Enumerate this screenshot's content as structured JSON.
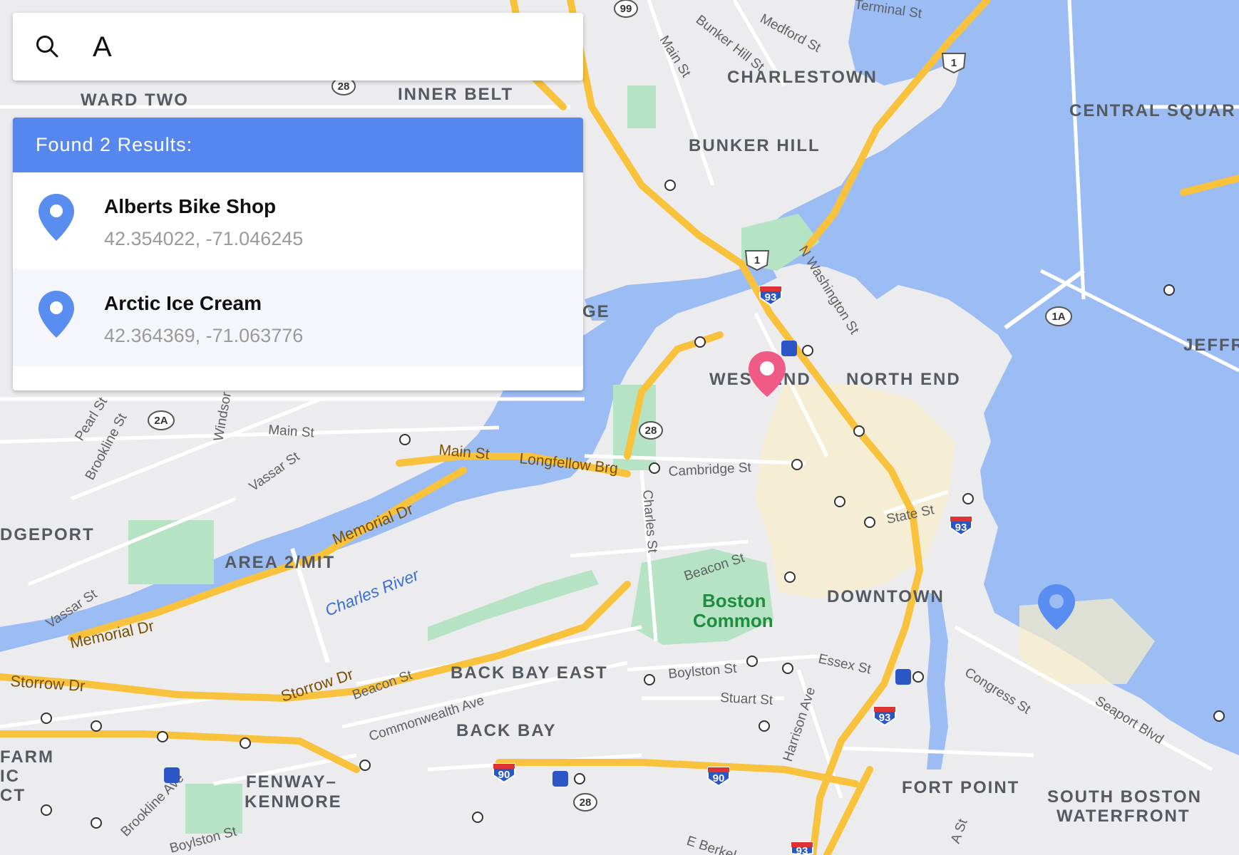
{
  "search": {
    "value": "A",
    "icon": "search-icon"
  },
  "results": {
    "header": "Found 2 Results:",
    "items": [
      {
        "name": "Alberts Bike Shop",
        "coords": "42.354022, -71.046245",
        "icon": "location-pin-icon",
        "color": "#5a8df0"
      },
      {
        "name": "Arctic Ice Cream",
        "coords": "42.364369, -71.063776",
        "icon": "location-pin-icon",
        "color": "#5a8df0"
      }
    ]
  },
  "map": {
    "colors": {
      "water": "#9cbcf4",
      "land": "#ececef",
      "park": "#b5e3c3",
      "highway": "#f8c23c",
      "accent_pin": "#ef5a86",
      "result_pin": "#5a8df0"
    },
    "neighborhoods": [
      "WARD TWO",
      "INNER BELT",
      "CHARLESTOWN",
      "BUNKER HILL",
      "CENTRAL SQUAR",
      "WEST END",
      "NORTH END",
      "JEFFR",
      "DGEPORT",
      "AREA 2/MIT",
      "DOWNTOWN",
      "BACK BAY EAST",
      "BACK BAY",
      "FENWAY–",
      "KENMORE",
      "FORT POINT",
      "SOUTH BOSTON",
      "WATERFRONT",
      "FARM",
      "IC",
      "CT",
      "GE"
    ],
    "streets": [
      "Medford St",
      "Bunker Hill St",
      "Main St",
      "N Washington St",
      "Pearl St",
      "Brookline St",
      "Windsor",
      "Main St",
      "Vassar St",
      "Main St",
      "Longfellow Brg",
      "Cambridge St",
      "Charles St",
      "State St",
      "Memorial Dr",
      "Beacon St",
      "Vassar St",
      "Memorial Dr",
      "Storrow Dr",
      "Storrow Dr",
      "Beacon St",
      "Commonwealth Ave",
      "Boylston St",
      "Essex St",
      "Stuart St",
      "Harrison Ave",
      "Congress St",
      "Seaport Blvd",
      "Brookline Ave",
      "Boylston St",
      "A St",
      "E Berkel",
      "Terminal St"
    ],
    "river": "Charles River",
    "park": [
      "Boston",
      "Common"
    ],
    "shields": [
      "99",
      "1",
      "28",
      "1",
      "93",
      "1A",
      "2A",
      "28",
      "93",
      "93",
      "90",
      "90",
      "28",
      "93"
    ]
  }
}
